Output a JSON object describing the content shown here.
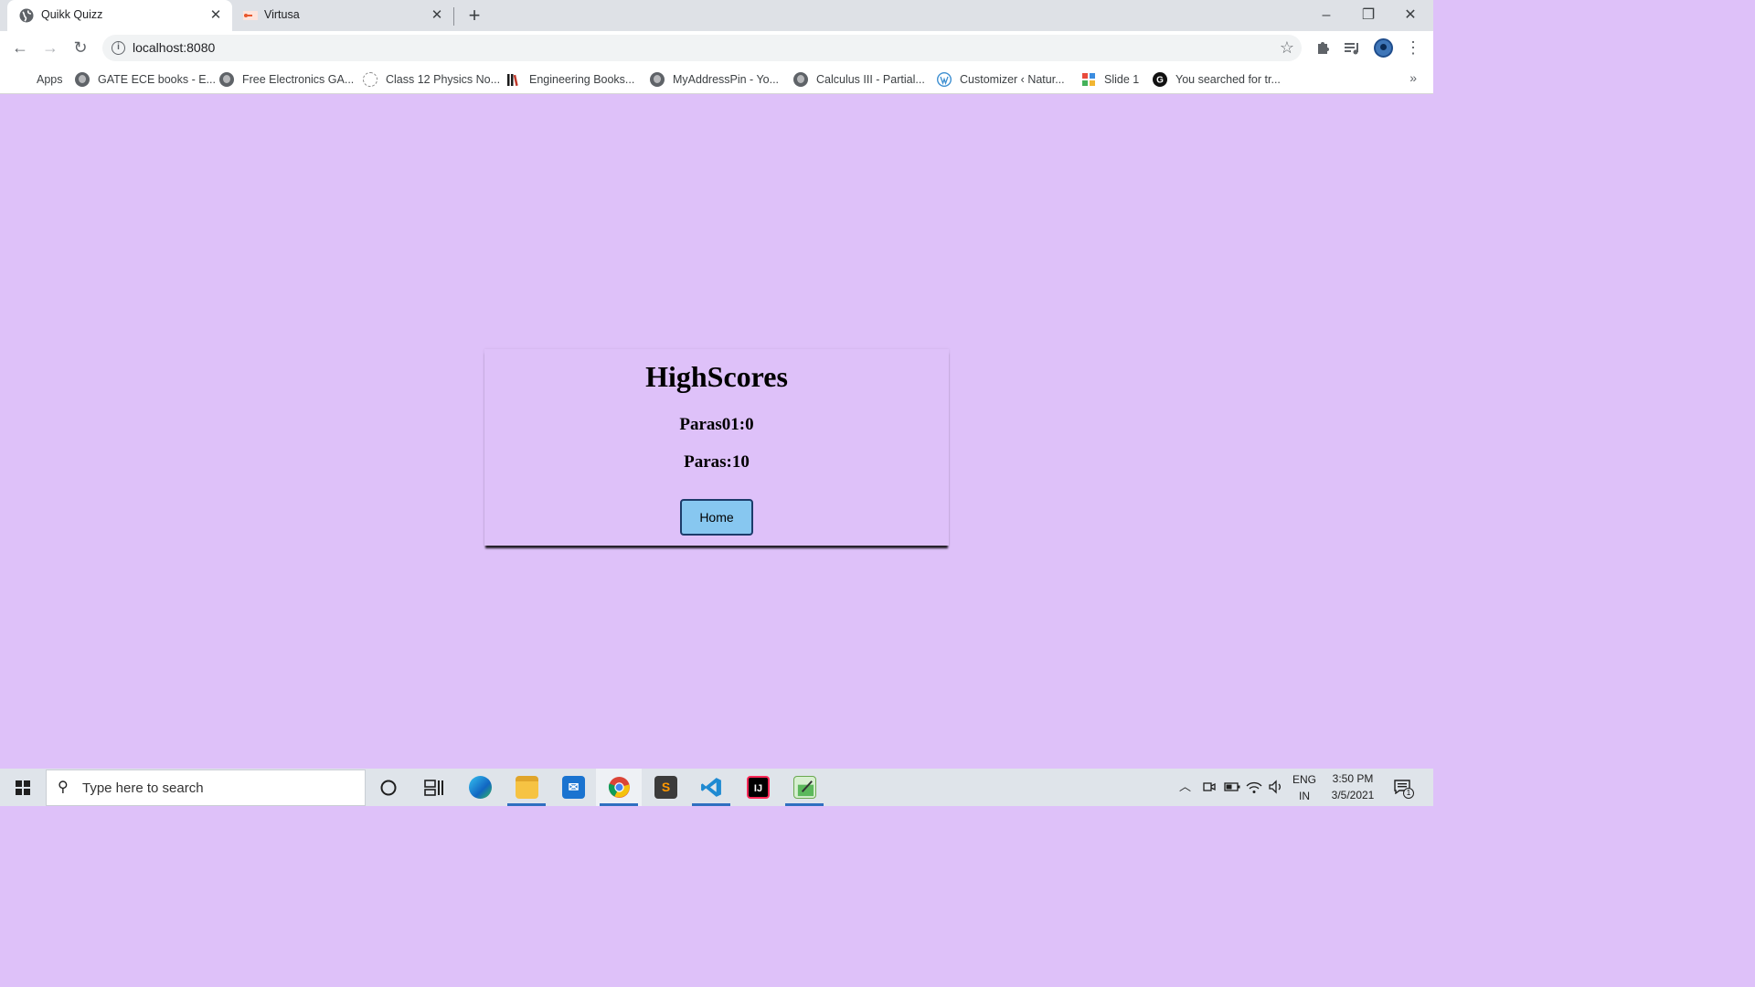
{
  "browser": {
    "tabs": [
      {
        "title": "Quikk Quizz",
        "active": true
      },
      {
        "title": "Virtusa",
        "active": false
      }
    ],
    "address": "localhost:8080",
    "bookmarks": {
      "apps_label": "Apps",
      "items": [
        "GATE ECE books - E...",
        "Free Electronics GA...",
        "Class 12 Physics No...",
        "Engineering Books...",
        "MyAddressPin - Yo...",
        "Calculus III - Partial...",
        "Customizer ‹ Natur...",
        "Slide 1",
        "You searched for tr..."
      ],
      "overflow": "»"
    }
  },
  "page": {
    "title": "HighScores",
    "scores": [
      "Paras01:0",
      "Paras:10"
    ],
    "home_button": "Home",
    "background": "#dec1f9",
    "button_color": "#87c7f0"
  },
  "taskbar": {
    "search_placeholder": "Type here to search",
    "lang_top": "ENG",
    "lang_bottom": "IN",
    "time": "3:50 PM",
    "date": "3/5/2021",
    "notification_count": "1"
  }
}
